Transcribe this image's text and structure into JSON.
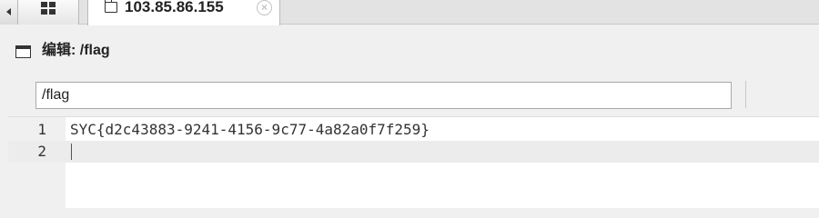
{
  "tabbar": {
    "grid_icon": "grid-icon",
    "tab": {
      "icon": "folder-icon",
      "title": "103.85.86.155",
      "close_symbol": "×"
    }
  },
  "editor": {
    "title": "编辑: /flag",
    "path_value": "/flag",
    "lines": [
      {
        "number": "1",
        "text": "SYC{d2c43883-9241-4156-9c77-4a82a0f7f259}"
      },
      {
        "number": "2",
        "text": ""
      }
    ]
  },
  "colors": {
    "background": "#f0f0f0",
    "editor_bg": "#ffffff",
    "current_line": "#ececec"
  }
}
